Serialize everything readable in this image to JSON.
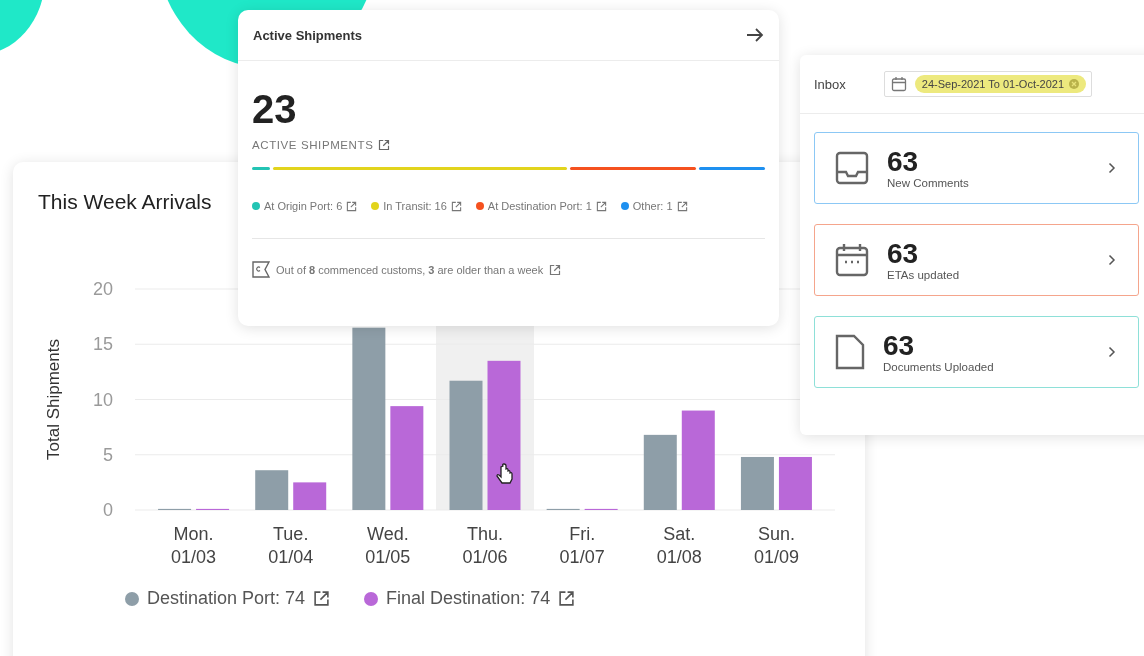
{
  "arrivals": {
    "title": "This Week Arrivals",
    "chart_data": {
      "type": "bar",
      "ylabel": "Total Shipments",
      "categories": [
        "Mon.\n01/03",
        "Tue.\n01/04",
        "Wed.\n01/05",
        "Thu.\n01/06",
        "Fri.\n01/07",
        "Sat.\n01/08",
        "Sun.\n01/09"
      ],
      "yticks": [
        0,
        5,
        10,
        15,
        20
      ],
      "ylim": [
        0,
        20
      ],
      "grid": true,
      "series": [
        {
          "name": "Destination Port: 74",
          "color": "#8e9ea8",
          "values": [
            0.1,
            3.6,
            16.5,
            11.7,
            0.1,
            6.8,
            4.8
          ]
        },
        {
          "name": "Final Destination: 74",
          "color": "#b968d8",
          "values": [
            0.1,
            2.5,
            9.4,
            13.5,
            0.1,
            9,
            4.8
          ]
        }
      ]
    },
    "hovered": [
      false,
      false,
      false,
      true,
      false,
      false,
      false
    ]
  },
  "active_shipments": {
    "title": "Active Shipments",
    "count": "23",
    "caption": "ACTIVE SHIPMENTS",
    "statuses": [
      {
        "label": "At Origin Port: 6",
        "color": "#23c4b4"
      },
      {
        "label": "In Transit: 16",
        "color": "#e2d41c"
      },
      {
        "label": "At Destination Port: 1",
        "color": "#f5511f"
      },
      {
        "label": "Other: 1",
        "color": "#1e90f0"
      }
    ],
    "customs_note": "Out of **8** commenced customs, **3** are older than a week"
  },
  "inbox": {
    "title": "Inbox",
    "date_range": "24-Sep-2021 To 01-Oct-2021",
    "cards": [
      {
        "kind": "inbox",
        "count": "63",
        "label": "New Comments",
        "color": "#8cc8f5"
      },
      {
        "kind": "calendar",
        "count": "63",
        "label": "ETAs updated",
        "color": "#f5a58c"
      },
      {
        "kind": "document",
        "count": "63",
        "label": "Documents Uploaded",
        "color": "#8ee0d8"
      }
    ]
  }
}
